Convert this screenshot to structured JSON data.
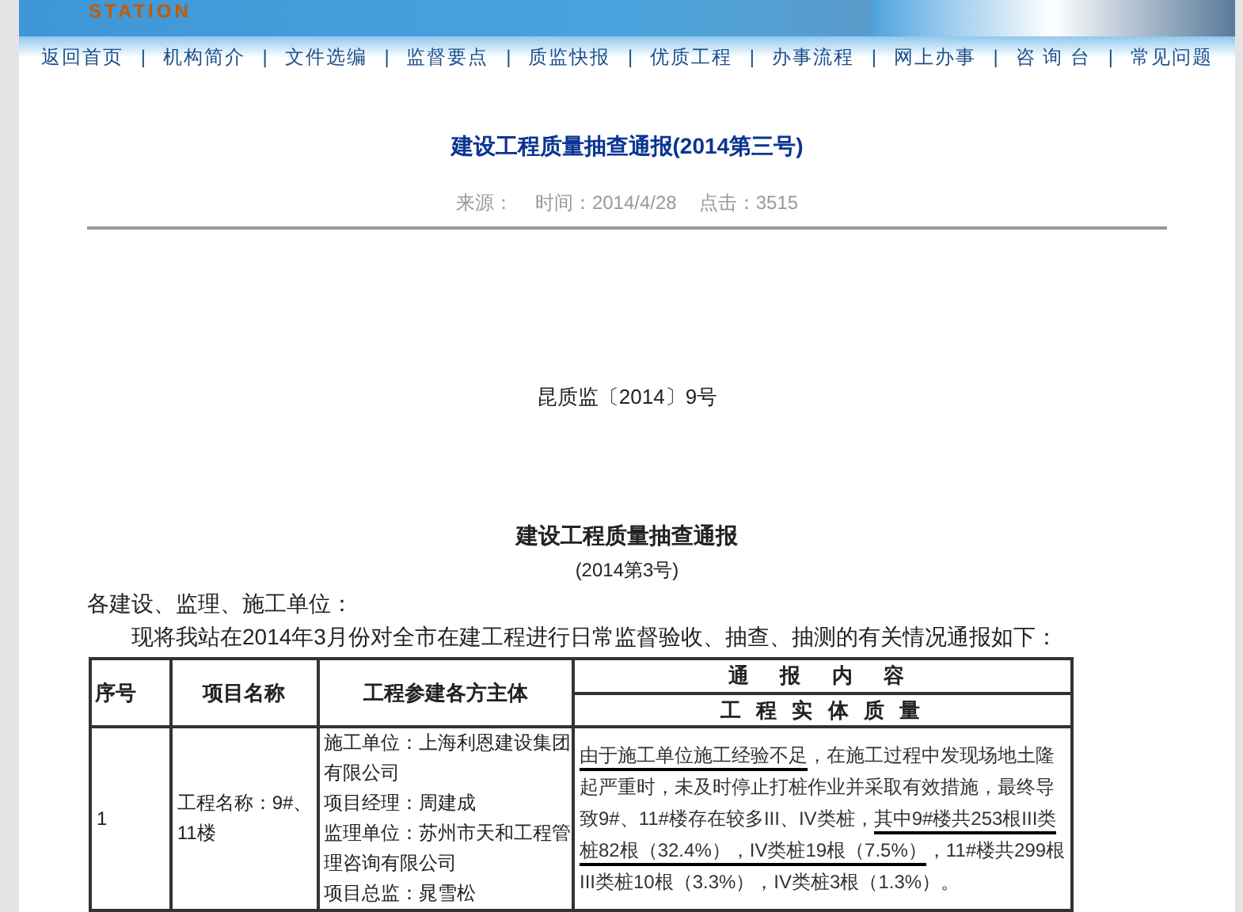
{
  "header": {
    "logo_text": "STATION"
  },
  "nav": [
    {
      "label": "返回首页"
    },
    {
      "label": "机构简介"
    },
    {
      "label": "文件选编"
    },
    {
      "label": "监督要点"
    },
    {
      "label": "质监快报"
    },
    {
      "label": "优质工程"
    },
    {
      "label": "办事流程"
    },
    {
      "label": "网上办事"
    },
    {
      "label": "咨 询 台"
    },
    {
      "label": "常见问题"
    }
  ],
  "nav_separators": [
    "|",
    "|",
    "|",
    "|",
    "|",
    "|",
    "|",
    "|",
    "|"
  ],
  "article": {
    "title": "建设工程质量抽查通报(2014第三号)",
    "meta": [
      "来源：",
      "时间：2014/4/28",
      "点击：3515"
    ],
    "doc_number": "昆质监〔2014〕9号",
    "heading": "建设工程质量抽查通报",
    "subheading": "(2014第3号)",
    "salutation": "各建设、监理、施工单位：",
    "intro": "现将我站在2014年3月份对全市在建工程进行日常监督验收、抽查、抽测的有关情况通报如下：",
    "table": {
      "columns": [
        "序号",
        "项目名称",
        "工程参建各方主体",
        "通 报 内 容"
      ],
      "subcolumn": "工 程 实 体 质 量",
      "rows": [
        {
          "number": "1",
          "project": "工程名称：9#、11楼",
          "parties": [
            "施工单位：上海利恩建设集团有限公司",
            "项目经理：周建成",
            "监理单位：苏州市天和工程管理咨询有限公司",
            "项目总监：晁雪松"
          ],
          "content": [
            {
              "text": "由于施工单位施工经验不足",
              "underlined": true
            },
            {
              "text": "，在施工过程中发现场地土隆起严重时，未及时停止打桩作业并采取有效措施，最终导致9#、11#楼存在较多III、IV类桩，",
              "underlined": false
            },
            {
              "text": "其中9#楼共253根III类桩82根（32.4%），",
              "underlined": true
            },
            {
              "text": "IV类桩19根（7.5%）",
              "underlined": true
            },
            {
              "text": "，11#楼共299根III类桩10根（3.3%），IV类桩3根（1.3%）。",
              "underlined": false
            }
          ]
        }
      ]
    }
  }
}
